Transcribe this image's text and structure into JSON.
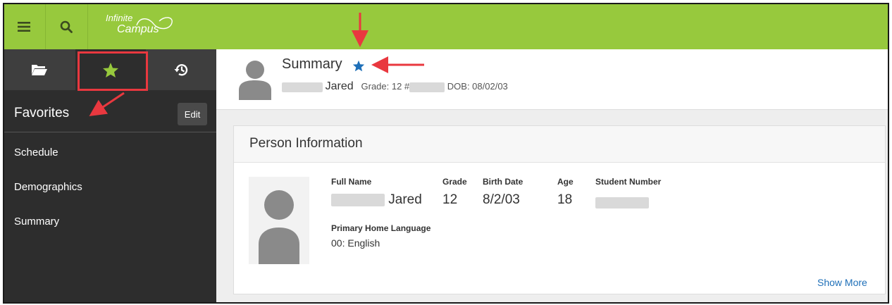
{
  "app": {
    "logo_line1": "Infinite",
    "logo_line2": "Campus",
    "accent_color": "#97c93d",
    "favorite_color": "#1e6fb8"
  },
  "topbar": {
    "icons": [
      "hamburger-menu-icon",
      "search-icon"
    ]
  },
  "sidebar": {
    "tabs": [
      {
        "name": "tab-folder",
        "icon": "folder-open-icon"
      },
      {
        "name": "tab-favorites",
        "icon": "star-icon",
        "active": true
      },
      {
        "name": "tab-history",
        "icon": "history-icon"
      }
    ],
    "title": "Favorites",
    "edit_label": "Edit",
    "items": [
      {
        "label": "Schedule"
      },
      {
        "label": "Demographics"
      },
      {
        "label": "Summary"
      }
    ]
  },
  "header": {
    "title": "Summary",
    "name": "Jared",
    "grade_text": "Grade: 12 #",
    "dob_text": "DOB: 08/02/03"
  },
  "person_info": {
    "title": "Person Information",
    "fields": {
      "full_name_label": "Full Name",
      "full_name_value": "Jared",
      "grade_label": "Grade",
      "grade_value": "12",
      "birth_date_label": "Birth Date",
      "birth_date_value": "8/2/03",
      "age_label": "Age",
      "age_value": "18",
      "student_number_label": "Student Number",
      "language_label": "Primary Home Language",
      "language_value": "00: English"
    },
    "show_more": "Show More"
  }
}
